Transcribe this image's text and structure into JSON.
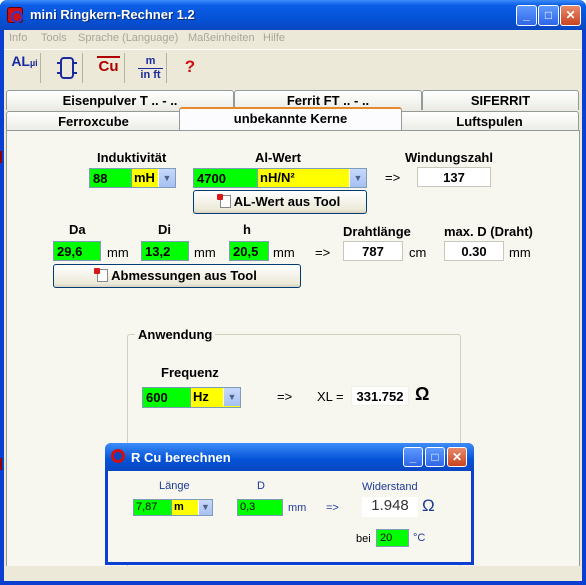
{
  "window": {
    "title": "mini Ringkern-Rechner 1.2",
    "icon": "ring-core-icon"
  },
  "menu": [
    "Info",
    "Tools",
    "Sprache (Language)",
    "Maßeinheiten",
    "Hilfe"
  ],
  "toolbar": {
    "al_label": "AL",
    "al_sub": "µi",
    "cu_label": "Cu",
    "m_label": "m",
    "ft_label": "in ft",
    "help_label": "?"
  },
  "tabs": {
    "row_top": [
      "Eisenpulver T .. - ..",
      "Ferrit FT .. - ..",
      "SIFERRIT"
    ],
    "row_bottom": [
      "Ferroxcube",
      "unbekannte Kerne",
      "Luftspulen"
    ],
    "active": "unbekannte Kerne"
  },
  "inductance": {
    "label": "Induktivität",
    "value": "88",
    "unit": "mH"
  },
  "al": {
    "label": "Al-Wert",
    "value": "4700",
    "unit": "nH/N²",
    "button": "AL-Wert aus Tool"
  },
  "turns": {
    "label": "Windungszahl",
    "arrow": "=>",
    "value": "137"
  },
  "dims": {
    "da_label": "Da",
    "da_value": "29,6",
    "da_unit": "mm",
    "di_label": "Di",
    "di_value": "13,2",
    "di_unit": "mm",
    "h_label": "h",
    "h_value": "20,5",
    "h_unit": "mm",
    "arrow": "=>",
    "button": "Abmessungen aus Tool"
  },
  "wire_length": {
    "label": "Drahtlänge",
    "value": "787",
    "unit": "cm"
  },
  "max_d": {
    "label": "max. D (Draht)",
    "value": "0.30",
    "unit": "mm"
  },
  "application": {
    "title": "Anwendung",
    "freq_label": "Frequenz",
    "freq_value": "600",
    "freq_unit": "Hz",
    "arrow": "=>",
    "xl_label": "XL =",
    "xl_value": "331.752",
    "xl_unit": "Ω"
  },
  "rcu": {
    "title": "R Cu berechnen",
    "length_label": "Länge",
    "length_value": "7,87",
    "length_unit": "m",
    "d_label": "D",
    "d_value": "0,3",
    "d_unit": "mm",
    "arrow": "=>",
    "resistance_label": "Widerstand",
    "resistance_value": "1.948",
    "resistance_unit": "Ω",
    "temp_prefix": "bei",
    "temp_value": "20",
    "temp_unit": "°C"
  }
}
